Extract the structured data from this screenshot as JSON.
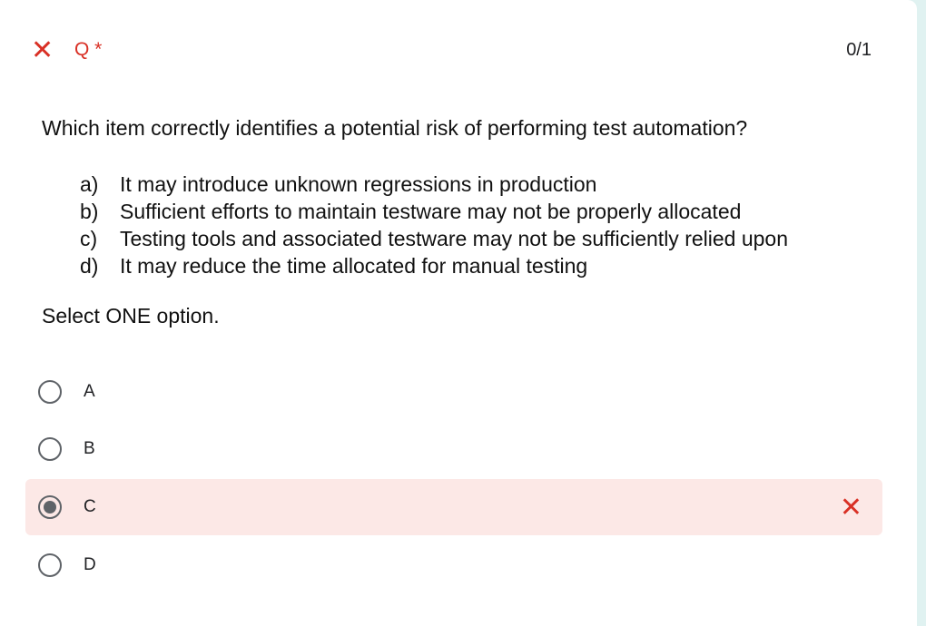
{
  "header": {
    "status_icon": "close-icon",
    "title": "Q *",
    "score": "0/1",
    "status_color": "#d93025"
  },
  "question": {
    "text": "Which item correctly identifies a potential risk of performing test automation?",
    "options": [
      {
        "key": "a)",
        "text": "It may introduce unknown regressions in production"
      },
      {
        "key": "b)",
        "text": "Sufficient efforts to maintain testware may not be properly allocated"
      },
      {
        "key": "c)",
        "text": "Testing tools and associated testware may not be sufficiently relied upon"
      },
      {
        "key": "d)",
        "text": "It may reduce the time allocated for manual testing"
      }
    ],
    "instruction": "Select ONE option."
  },
  "choices": [
    {
      "label": "A",
      "selected": false
    },
    {
      "label": "B",
      "selected": false
    },
    {
      "label": "C",
      "selected": true,
      "incorrect": true
    },
    {
      "label": "D",
      "selected": false
    }
  ]
}
